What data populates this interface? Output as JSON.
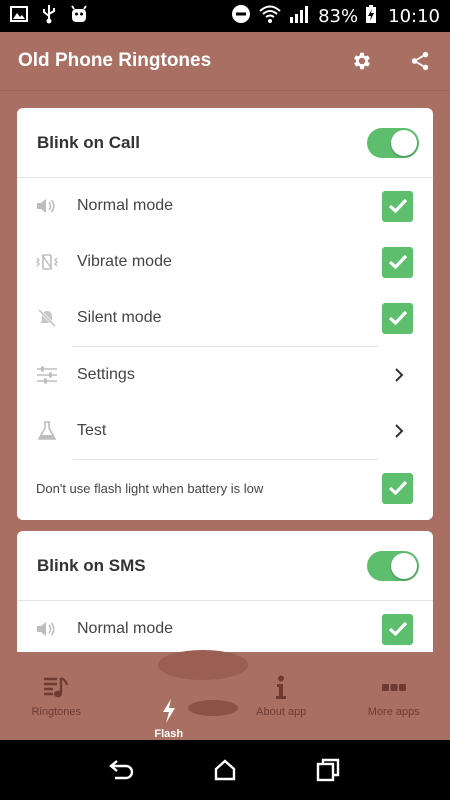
{
  "status_bar": {
    "battery": "83%",
    "time": "10:10"
  },
  "app_bar": {
    "title": "Old Phone Ringtones"
  },
  "cards": [
    {
      "title": "Blink on Call",
      "toggle_on": true,
      "rows": [
        {
          "icon": "speaker-icon",
          "label": "Normal mode",
          "checked": true
        },
        {
          "icon": "vibrate-icon",
          "label": "Vibrate mode",
          "checked": true
        },
        {
          "icon": "silent-icon",
          "label": "Silent mode",
          "checked": true
        },
        {
          "icon": "sliders-icon",
          "label": "Settings"
        },
        {
          "icon": "flask-icon",
          "label": "Test"
        },
        {
          "label": "Don't use flash light when battery is low",
          "checked": true
        }
      ]
    },
    {
      "title": "Blink on SMS",
      "toggle_on": true,
      "rows": [
        {
          "icon": "speaker-icon",
          "label": "Normal mode",
          "checked": true
        }
      ]
    }
  ],
  "bottom_nav": [
    {
      "icon": "ringtones-icon",
      "label": "Ringtones",
      "active": false
    },
    {
      "icon": "flash-icon",
      "label": "Flash",
      "active": true
    },
    {
      "icon": "info-icon",
      "label": "About app",
      "active": false
    },
    {
      "icon": "more-dots-icon",
      "label": "More apps",
      "active": false
    }
  ],
  "colors": {
    "primary": "#a96f62",
    "accent_green": "#5dbf6e",
    "nav_inactive": "#6e3b33"
  }
}
